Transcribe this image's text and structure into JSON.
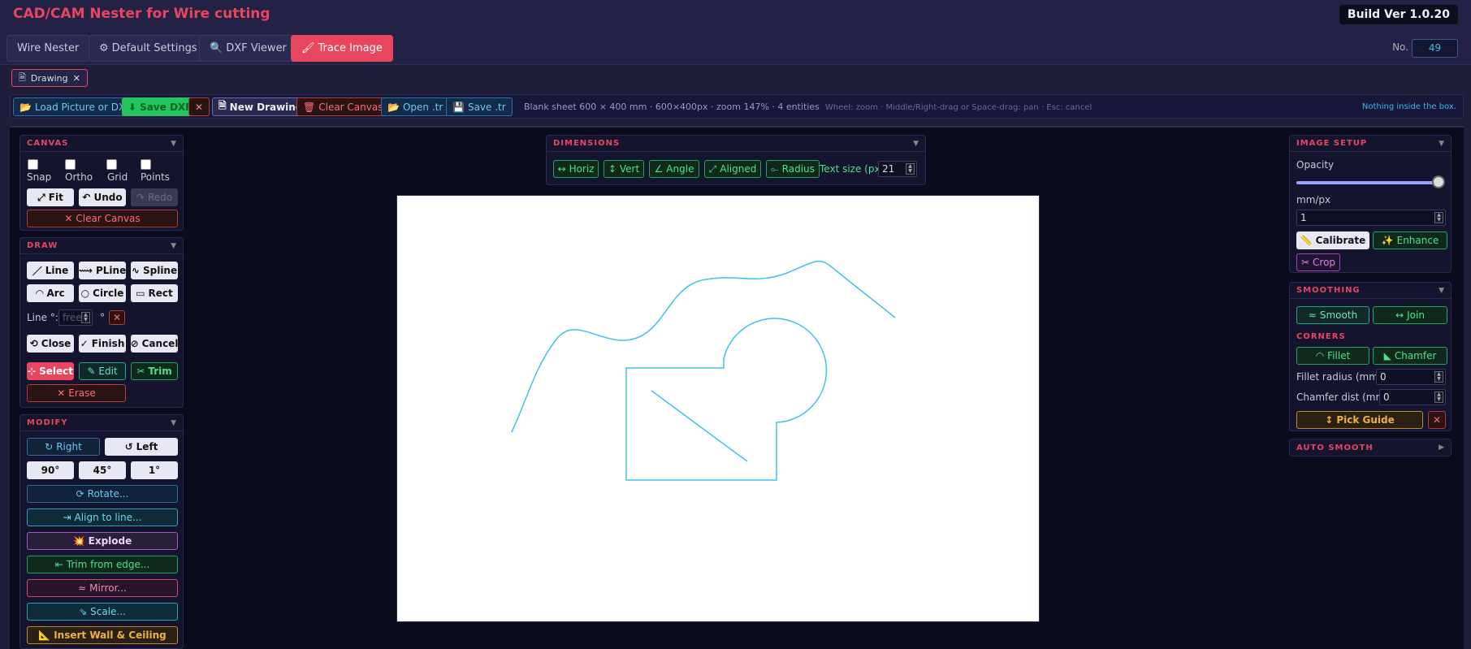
{
  "app": {
    "title": "CAD/CAM Nester for Wire cutting",
    "build": "Build Ver 1.0.20"
  },
  "nav": {
    "wire_nester": "Wire Nester",
    "default_settings": "Default Settings",
    "dxf_viewer": "DXF Viewer",
    "trace_image": "Trace Image",
    "no_label": "No.",
    "no_value": "49"
  },
  "doc_tab": {
    "label": "Drawing"
  },
  "toolbar": {
    "load": "Load Picture or DXF",
    "save_dxf": "Save DXF",
    "close": "✕",
    "new_drawing": "New Drawing",
    "clear_canvas": "Clear Canvas",
    "open_tr": "Open .tr",
    "save_tr": "Save .tr",
    "status": "Blank sheet 600 × 400 mm · 600×400px · zoom 147% · 4 entities",
    "hint": "Wheel: zoom · Middle/Right-drag or Space-drag: pan · Esc: cancel",
    "right_msg": "Nothing inside the box."
  },
  "canvas_panel": {
    "title": "CANVAS",
    "snap": "Snap",
    "ortho": "Ortho",
    "grid": "Grid",
    "points": "Points",
    "fit": "Fit",
    "undo": "Undo",
    "redo": "Redo",
    "clear": "Clear Canvas"
  },
  "draw_panel": {
    "title": "DRAW",
    "line": "Line",
    "pline": "PLine",
    "spline": "Spline",
    "arc": "Arc",
    "circle": "Circle",
    "rect": "Rect",
    "line_angle_label": "Line °:",
    "line_angle_placeholder": "free",
    "degree": "°",
    "close": "Close",
    "finish": "Finish",
    "cancel": "Cancel",
    "select": "Select",
    "edit": "Edit",
    "trim": "Trim",
    "erase": "Erase"
  },
  "modify_panel": {
    "title": "MODIFY",
    "right": "Right",
    "left": "Left",
    "deg90": "90°",
    "deg45": "45°",
    "deg1": "1°",
    "rotate": "Rotate...",
    "align": "Align to line...",
    "explode": "Explode",
    "trim_edge": "Trim from edge...",
    "mirror": "Mirror...",
    "scale": "Scale...",
    "wall": "Insert Wall & Ceiling"
  },
  "dimensions_panel": {
    "title": "DIMENSIONS",
    "horiz": "Horiz",
    "vert": "Vert",
    "angle": "Angle",
    "aligned": "Aligned",
    "radius": "Radius",
    "text_size_label": "Text size (px)",
    "text_size": "21"
  },
  "image_setup": {
    "title": "IMAGE SETUP",
    "opacity_label": "Opacity",
    "opacity_value": 1.0,
    "mmpx_label": "mm/px",
    "mmpx_value": "1",
    "calibrate": "Calibrate",
    "enhance": "Enhance",
    "crop": "Crop"
  },
  "smoothing": {
    "title": "SMOOTHING",
    "smooth": "Smooth",
    "join": "Join",
    "corners_title": "CORNERS",
    "fillet": "Fillet",
    "chamfer": "Chamfer",
    "fillet_radius_label": "Fillet radius (mm)",
    "fillet_radius": "0",
    "chamfer_dist_label": "Chamfer dist (mm)",
    "chamfer_dist": "0",
    "pick_guide": "Pick Guide",
    "pick_close": "✕"
  },
  "auto_smooth": {
    "title": "AUTO SMOOTH"
  },
  "colors": {
    "accent": "#e8455e",
    "stroke": "#3ec1ee",
    "sheet": "#ffffff",
    "bg": "#1e1d3a"
  }
}
